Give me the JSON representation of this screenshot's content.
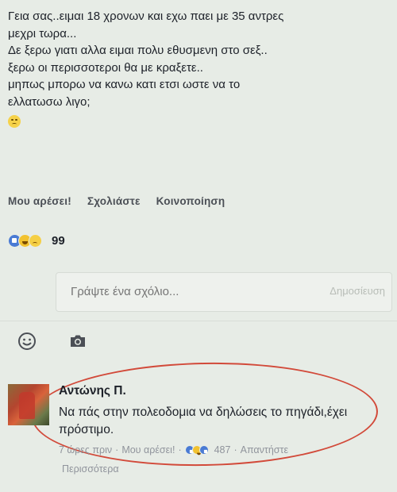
{
  "post": {
    "lines": [
      "Γεια σας..ειμαι 18 χρονων και εχω παει με 35 αντρες",
      "μεχρι τωρα...",
      "Δε ξερω γιατι αλλα ειμαι πολυ εθυσμενη στο σεξ..",
      "ξερω οι περισσοτεροι θα με κραξετε..",
      "μηπως μπορω να κανω κατι ετσι ωστε να το",
      "ελλατωσω λιγο;"
    ],
    "emoji": "sad-face-icon"
  },
  "actions": {
    "like": "Μου αρέσει!",
    "comment": "Σχολιάστε",
    "share": "Κοινοποίηση"
  },
  "reactions": {
    "icons": [
      "like-icon",
      "haha-icon",
      "sad-icon"
    ],
    "count": "99"
  },
  "composer": {
    "placeholder": "Γράψτε ένα σχόλιο...",
    "publish": "Δημοσίευση"
  },
  "tools": {
    "emoji": "smiley-icon",
    "camera": "camera-icon"
  },
  "comment": {
    "author": "Αντώνης Π.",
    "text": "Να πάς στην πολεοδομια να δηλώσεις το πηγάδι,έχει πρόστιμο.",
    "time": "7 ώρες πριν",
    "like": "Μου αρέσει!",
    "reaction_count": "487",
    "reply": "Απαντήστε",
    "more": "Περισσότερα"
  },
  "colors": {
    "background": "#e7ece6",
    "highlight": "#d24a3a",
    "like_blue": "#4a7bd4"
  }
}
